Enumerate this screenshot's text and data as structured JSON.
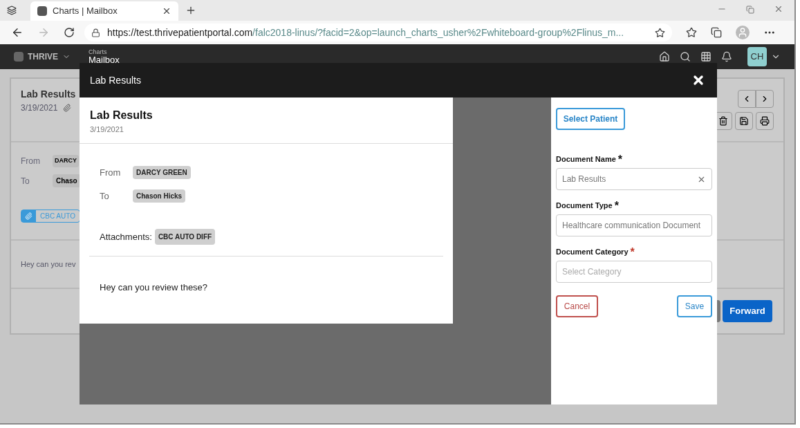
{
  "browser": {
    "tab_title": "Charts | Mailbox",
    "url_host": "https://test.thrivepatientportal.com",
    "url_path": "/falc2018-linus/?facid=2&op=launch_charts_usher%2Fwhiteboard-group%2Flinus_m..."
  },
  "app_header": {
    "brand": "THRIVE",
    "section": "Charts",
    "page": "Mailbox",
    "avatar": "CH"
  },
  "message_behind": {
    "title": "Lab Results",
    "date": "3/19/2021",
    "from_label": "From",
    "from": "DARCY",
    "to_label": "To",
    "to": "Chaso",
    "attachment": "CBC AUTO",
    "body": "Hey can you rev",
    "forward": "Forward"
  },
  "modal": {
    "title": "Lab Results",
    "preview": {
      "title": "Lab Results",
      "date": "3/19/2021",
      "from_label": "From",
      "from": "DARCY GREEN",
      "to_label": "To",
      "to": "Chason Hicks",
      "attachments_label": "Attachments:",
      "attachments": [
        "CBC AUTO DIFF"
      ],
      "body": "Hey can you review these?"
    },
    "form": {
      "select_patient": "Select Patient",
      "fields": [
        {
          "kind": "text",
          "label": "Document Name",
          "required_mark": "*",
          "color": "#111111",
          "value": "Lab Results",
          "clearable": true
        },
        {
          "kind": "text",
          "label": "Document Type",
          "required_mark": "*",
          "color": "#111111",
          "value": "Healthcare communication Document",
          "clearable": false
        },
        {
          "kind": "select",
          "label": "Document Category",
          "required_mark": "*",
          "color": "#c0392b",
          "placeholder": "Select Category",
          "clearable": false
        }
      ],
      "cancel": "Cancel",
      "save": "Save"
    }
  }
}
